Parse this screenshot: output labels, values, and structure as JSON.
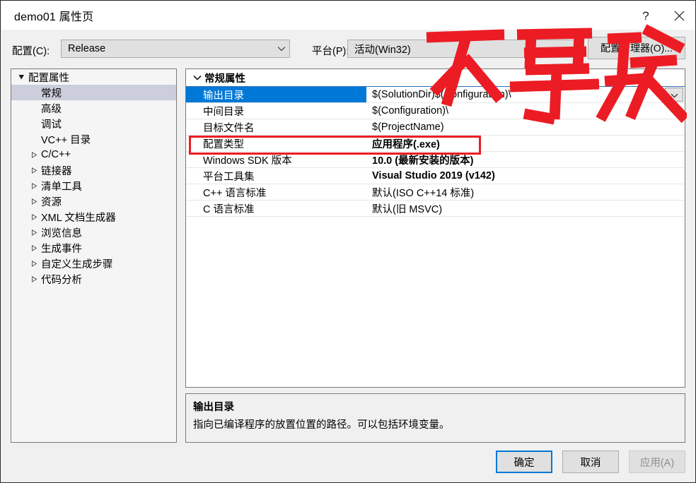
{
  "window": {
    "title": "demo01 属性页",
    "help_glyph": "?",
    "close_icon": "close-icon"
  },
  "configbar": {
    "config_label": "配置(C):",
    "config_value": "Release",
    "platform_label": "平台(P):",
    "platform_value": "活动(Win32)",
    "config_manager_button": "配置管理器(O)..."
  },
  "tree": {
    "items": [
      {
        "label": "配置属性",
        "level": 0,
        "twisty": "expanded",
        "selected": false
      },
      {
        "label": "常规",
        "level": 1,
        "twisty": "none",
        "selected": true
      },
      {
        "label": "高级",
        "level": 1,
        "twisty": "none",
        "selected": false
      },
      {
        "label": "调试",
        "level": 1,
        "twisty": "none",
        "selected": false
      },
      {
        "label": "VC++ 目录",
        "level": 1,
        "twisty": "none",
        "selected": false
      },
      {
        "label": "C/C++",
        "level": 1,
        "twisty": "collapsed",
        "selected": false
      },
      {
        "label": "链接器",
        "level": 1,
        "twisty": "collapsed",
        "selected": false
      },
      {
        "label": "清单工具",
        "level": 1,
        "twisty": "collapsed",
        "selected": false
      },
      {
        "label": "资源",
        "level": 1,
        "twisty": "collapsed",
        "selected": false
      },
      {
        "label": "XML 文档生成器",
        "level": 1,
        "twisty": "collapsed",
        "selected": false
      },
      {
        "label": "浏览信息",
        "level": 1,
        "twisty": "collapsed",
        "selected": false
      },
      {
        "label": "生成事件",
        "level": 1,
        "twisty": "collapsed",
        "selected": false
      },
      {
        "label": "自定义生成步骤",
        "level": 1,
        "twisty": "collapsed",
        "selected": false
      },
      {
        "label": "代码分析",
        "level": 1,
        "twisty": "collapsed",
        "selected": false
      }
    ]
  },
  "properties": {
    "group_title": "常规属性",
    "rows": [
      {
        "name": "输出目录",
        "value": "$(SolutionDir)$(Configuration)\\",
        "bold": false,
        "selected": true,
        "dropdown": true
      },
      {
        "name": "中间目录",
        "value": "$(Configuration)\\",
        "bold": false,
        "selected": false,
        "dropdown": false
      },
      {
        "name": "目标文件名",
        "value": "$(ProjectName)",
        "bold": false,
        "selected": false,
        "dropdown": false
      },
      {
        "name": "配置类型",
        "value": "应用程序(.exe)",
        "bold": true,
        "selected": false,
        "dropdown": false
      },
      {
        "name": "Windows SDK 版本",
        "value": "10.0 (最新安装的版本)",
        "bold": true,
        "selected": false,
        "dropdown": false
      },
      {
        "name": "平台工具集",
        "value": "Visual Studio 2019 (v142)",
        "bold": true,
        "selected": false,
        "dropdown": false
      },
      {
        "name": "C++ 语言标准",
        "value": "默认(ISO C++14 标准)",
        "bold": false,
        "selected": false,
        "dropdown": false
      },
      {
        "name": "C 语言标准",
        "value": "默认(旧 MSVC)",
        "bold": false,
        "selected": false,
        "dropdown": false
      }
    ]
  },
  "description": {
    "title": "输出目录",
    "body": "指向已编译程序的放置位置的路径。可以包括环境变量。"
  },
  "buttons": {
    "ok": "确定",
    "cancel": "取消",
    "apply": "应用(A)"
  },
  "annotation": {
    "text": "不要改",
    "color": "#ec1c24",
    "highlight_target": "配置类型"
  }
}
